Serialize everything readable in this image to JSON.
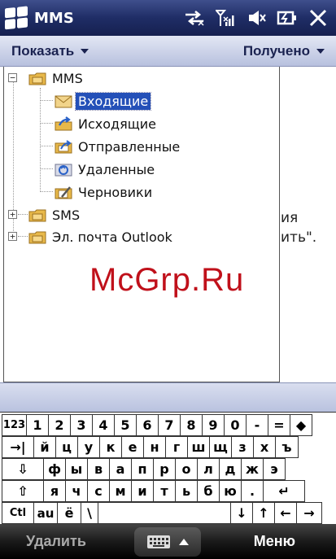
{
  "titlebar": {
    "title": "MMS",
    "icons": [
      "windows-logo-icon",
      "sync-icon",
      "signal-icon",
      "volume-muted-icon",
      "battery-icon",
      "close-icon"
    ]
  },
  "menubar": {
    "left_label": "Показать",
    "right_label": "Получено"
  },
  "background": {
    "line1": "ия",
    "line2": "ить\"."
  },
  "tree": {
    "nodes": [
      {
        "label": "MMS",
        "expander": "−",
        "icon": "account-folder-icon"
      },
      {
        "label": "Входящие",
        "icon": "inbox-icon",
        "selected": true
      },
      {
        "label": "Исходящие",
        "icon": "outbox-icon"
      },
      {
        "label": "Отправленные",
        "icon": "sent-items-icon"
      },
      {
        "label": "Удаленные",
        "icon": "deleted-items-icon"
      },
      {
        "label": "Черновики",
        "icon": "drafts-icon"
      },
      {
        "label": "SMS",
        "expander": "+",
        "icon": "account-folder-icon"
      },
      {
        "label": "Эл. почта Outlook",
        "expander": "+",
        "icon": "account-folder-icon"
      }
    ]
  },
  "keyboard": {
    "row1": [
      "123",
      "1",
      "2",
      "3",
      "4",
      "5",
      "6",
      "7",
      "8",
      "9",
      "0",
      "-",
      "=",
      "◆"
    ],
    "row2": [
      "→|",
      "й",
      "ц",
      "у",
      "к",
      "е",
      "н",
      "г",
      "ш",
      "щ",
      "з",
      "х",
      "ъ"
    ],
    "row3": [
      "⇩",
      "ф",
      "ы",
      "в",
      "а",
      "п",
      "р",
      "о",
      "л",
      "д",
      "ж",
      "э"
    ],
    "row4": [
      "⇧",
      "я",
      "ч",
      "с",
      "м",
      "и",
      "т",
      "ь",
      "б",
      "ю",
      ".",
      "↵"
    ],
    "row5": [
      "Ctl",
      "au",
      "ё",
      "\\",
      " ",
      "↓",
      "↑",
      "←",
      "→"
    ]
  },
  "softkeys": {
    "left": "Удалить",
    "right": "Меню"
  },
  "watermark": "McGrp.Ru",
  "colors": {
    "titlebar": "#1f2d66",
    "selection": "#2450b8",
    "watermark": "#c0101a"
  }
}
